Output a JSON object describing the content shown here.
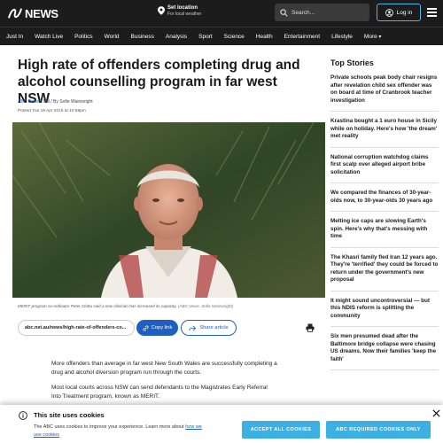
{
  "header": {
    "logo_text": "NEWS",
    "set_location": "Set location",
    "set_location_sub": "For local weather",
    "search_placeholder": "Search...",
    "login_label": "Log in"
  },
  "nav": {
    "items": [
      "Just In",
      "Watch Live",
      "Politics",
      "World",
      "Business",
      "Analysis",
      "Sport",
      "Science",
      "Health",
      "Entertainment",
      "Lifestyle",
      "More"
    ]
  },
  "article": {
    "headline": "High rate of offenders completing drug and alcohol counselling program in far west NSW",
    "source": "ABC Broken Hill",
    "author_prefix": "/ By Sofie Wainwright",
    "posted": "Posted Tue 19 Apr 2016 at 10:58pm",
    "caption": "MERIT program co-ordinator Peter Clottu said a new clinician has increased its capacity.",
    "caption_credit": "(ABC News: Sofie Wainwright)",
    "share_url": "abc.net.au/news/high-rate-of-offenders-co...",
    "copy_link": "Copy link",
    "share_article": "Share article",
    "paragraph1": "More offenders than average in far west New South Wales are successfully completing a drug and alcohol diversion program run through the courts.",
    "paragraph2": "Most local courts across NSW can send defendants to the Magistrates Early Referral Into Treatment program, known as MERIT."
  },
  "sidebar": {
    "title": "Top Stories",
    "stories": [
      "Private schools peak body chair resigns after revelation child sex offender was on board at time of Cranbrook teacher investigation",
      "Krastina bought a 1 euro house in Sicily while on holiday. Here's how 'the dream' met reality",
      "National corruption watchdog claims first scalp over alleged airport bribe solicitation",
      "We compared the finances of 30-year-olds now, to 30-year-olds 30 years ago",
      "Melting ice caps are slowing Earth's spin. Here's why that's messing with time",
      "The Khasri family fled Iran 12 years ago. They're 'terrified' they could be forced to return under the government's new proposal",
      "It might sound uncontroversial — but this NDIS reform is splitting the community",
      "Six men presumed dead after the Baltimore bridge collapse were chasing US dreams. Now their families 'keep the faith'"
    ]
  },
  "cookie": {
    "title": "This site uses cookies",
    "text": "The ABC uses cookies to improve your experience. Learn more about",
    "link": "how we use cookies",
    "accept_all": "ACCEPT ALL COOKIES",
    "required_only": "ABC REQUIRED COOKIES ONLY"
  },
  "colors": {
    "header_bg": "#1c1c1c",
    "link_blue": "#1f5fbf",
    "cookie_button": "#3cb0e3",
    "login_border": "#4db7e8"
  }
}
